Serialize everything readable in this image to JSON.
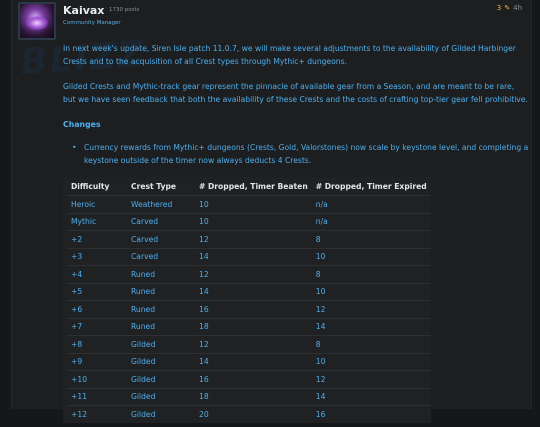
{
  "post": {
    "author": "Kaivax",
    "post_count": "1730 posts",
    "role": "Community Manager",
    "likes": "3",
    "time_ago": "4h",
    "watermark": "BLIZZ"
  },
  "intro": "In next week's update, Siren Isle patch 11.0.7, we will make several adjustments to the availability of Gilded Harbinger Crests and to the acquisition of all Crest types through Mythic+ dungeons.",
  "paragraph2": "Gilded Crests and Mythic-track gear represent the pinnacle of available gear from a Season, and are meant to be rare, but we have seen feedback that both the availability of these Crests and the costs of crafting top-tier gear fell prohibitive.",
  "changes_heading": "Changes",
  "bullets": [
    "Currency rewards from Mythic+ dungeons (Crests, Gold, Valorstones) now scale by keystone level, and completing a keystone outside of the timer now always deducts 4 Crests."
  ],
  "table": {
    "headers": [
      "Difficulty",
      "Crest Type",
      "# Dropped, Timer Beaten",
      "# Dropped, Timer Expired"
    ],
    "rows": [
      [
        "Heroic",
        "Weathered",
        "10",
        "n/a"
      ],
      [
        "Mythic",
        "Carved",
        "10",
        "n/a"
      ],
      [
        "+2",
        "Carved",
        "12",
        "8"
      ],
      [
        "+3",
        "Carved",
        "14",
        "10"
      ],
      [
        "+4",
        "Runed",
        "12",
        "8"
      ],
      [
        "+5",
        "Runed",
        "14",
        "10"
      ],
      [
        "+6",
        "Runed",
        "16",
        "12"
      ],
      [
        "+7",
        "Runed",
        "18",
        "14"
      ],
      [
        "+8",
        "Gilded",
        "12",
        "8"
      ],
      [
        "+9",
        "Gilded",
        "14",
        "10"
      ],
      [
        "+10",
        "Gilded",
        "16",
        "12"
      ],
      [
        "+11",
        "Gilded",
        "18",
        "14"
      ],
      [
        "+12",
        "Gilded",
        "20",
        "16"
      ]
    ]
  },
  "colors": {
    "accent": "#4db0ef",
    "like": "#f0b43c",
    "background": "#1c1e20"
  }
}
